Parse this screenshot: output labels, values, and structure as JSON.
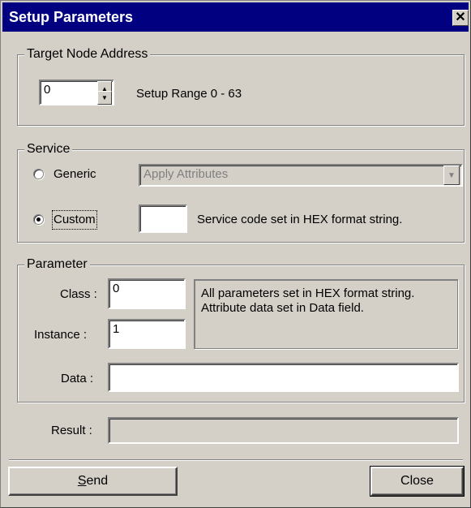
{
  "window": {
    "title": "Setup Parameters",
    "close_glyph": "✕"
  },
  "target": {
    "group_label": "Target Node Address",
    "node_value": "0",
    "range_text": "Setup Range 0 - 63"
  },
  "service": {
    "group_label": "Service",
    "generic_label": "Generic",
    "custom_label": "Custom",
    "selected": "custom",
    "combo_value": "Apply Attributes",
    "code_value": "",
    "hint": "Service code set in HEX format string."
  },
  "parameter": {
    "group_label": "Parameter",
    "class_label": "Class :",
    "class_value": "0",
    "instance_label": "Instance :",
    "instance_value": "1",
    "data_label": "Data :",
    "data_value": "",
    "note_line1": "All parameters set in HEX format string.",
    "note_line2": "Attribute data set in Data field."
  },
  "result": {
    "label": "Result :",
    "value": ""
  },
  "buttons": {
    "send_mnemonic": "S",
    "send_rest": "end",
    "close_label": "Close"
  }
}
